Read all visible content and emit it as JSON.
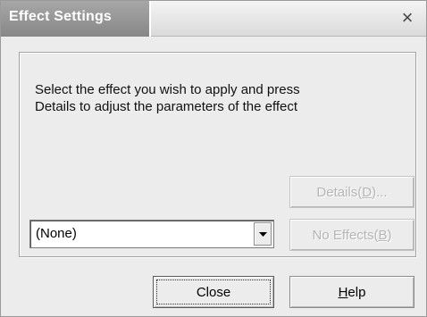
{
  "window": {
    "title": "Effect Settings",
    "close_glyph": "×"
  },
  "content": {
    "description_line1": "Select the effect you wish to apply and press",
    "description_line2": "Details to adjust the parameters of the effect"
  },
  "effect_select": {
    "selected_value": "(None)"
  },
  "buttons": {
    "details": {
      "label": "Details(",
      "accel": "D",
      "suffix": ")...",
      "enabled": false
    },
    "no_effects": {
      "label": "No Effects(",
      "accel": "B",
      "suffix": ")",
      "enabled": false
    },
    "close": {
      "label": "Close"
    },
    "help": {
      "accel": "H",
      "label_rest": "elp"
    }
  },
  "icons": {
    "close": "close-icon",
    "dropdown": "chevron-down-icon"
  }
}
